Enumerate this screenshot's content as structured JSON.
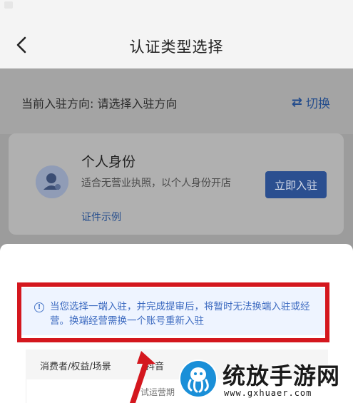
{
  "nav": {
    "title": "认证类型选择"
  },
  "direction": {
    "label": "当前入驻方向: 请选择入驻方向",
    "switch_label": "切换",
    "switch_icon": "⇄"
  },
  "card": {
    "title": "个人身份",
    "description": "适合无营业执照，以个人身份开店",
    "link": "证件示例",
    "button": "立即入驻"
  },
  "notice": {
    "icon": "!",
    "text": "当您选择一端入驻，并完成提审后，将暂时无法换端入驻或经营。换端经营需换一个账号重新入驻"
  },
  "table": {
    "headers": [
      "消费者/权益/场景",
      "抖音"
    ],
    "row_fragment": "试运营期"
  },
  "watermark": {
    "title": "统放手游网",
    "url": "www.gxhuaer.com"
  },
  "colors": {
    "accent": "#2b4f90",
    "warning_frame": "#d4171e",
    "notice_text": "#3c6ac0"
  }
}
